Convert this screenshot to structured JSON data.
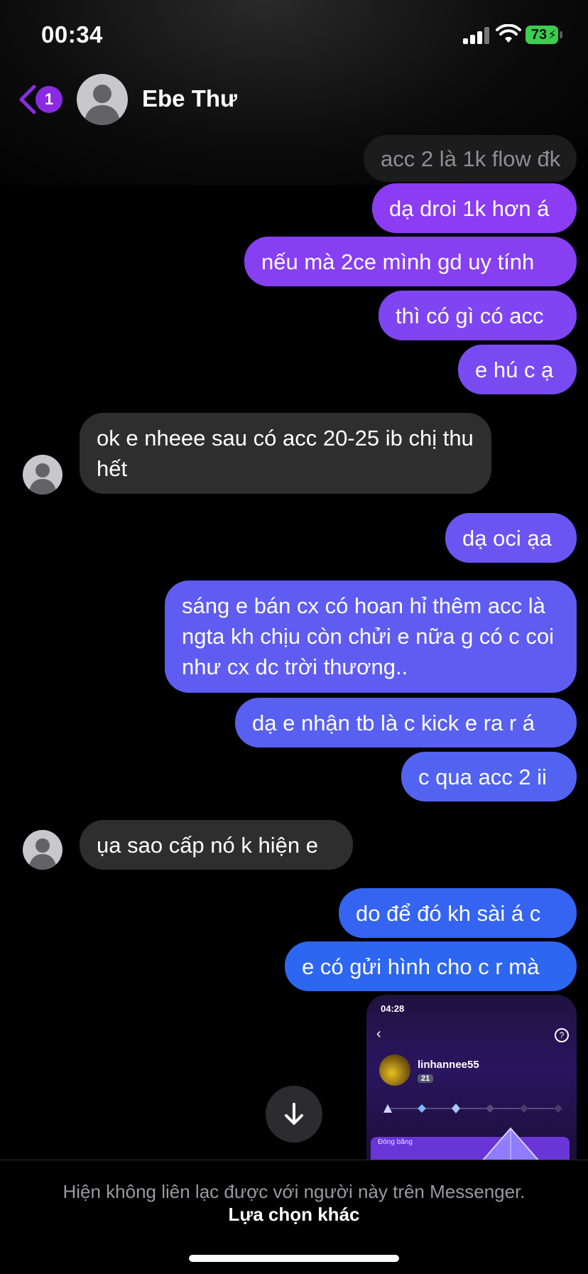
{
  "status_bar": {
    "time": "00:34",
    "battery": "73"
  },
  "header": {
    "unread_count": "1",
    "contact_name": "Ebe Thư"
  },
  "messages": [
    {
      "from": "them",
      "text": "acc 2 là 1k flow đk"
    },
    {
      "from": "me",
      "text": "dạ droi 1k hơn á"
    },
    {
      "from": "me",
      "text": "nếu mà 2ce mình gd uy tính"
    },
    {
      "from": "me",
      "text": "thì có gì có acc"
    },
    {
      "from": "me",
      "text": "e hú c ạ"
    },
    {
      "from": "them",
      "text": "ok e nheee sau có acc 20-25 ib chị thu hết"
    },
    {
      "from": "me",
      "text": "dạ oci ạa"
    },
    {
      "from": "me",
      "text": "sáng e bán cx có hoan hỉ thêm acc là ngta kh chịu còn chửi e nữa g có c coi như cx dc trời thương.."
    },
    {
      "from": "me",
      "text": "dạ e nhận tb là c kick e ra r á"
    },
    {
      "from": "me",
      "text": "c qua acc 2 ii"
    },
    {
      "from": "them",
      "text": "ụa sao cấp nó k hiện e"
    },
    {
      "from": "me",
      "text": "do để đó kh sài á c"
    },
    {
      "from": "me",
      "text": "e có gửi hình cho c r mà"
    }
  ],
  "attachment": {
    "time": "04:28",
    "username": "linhannee55",
    "level": "21",
    "card_label": "Đóng băng"
  },
  "footer": {
    "notice": "Hiện không liên lạc được với người này trên Messenger.",
    "other_options": "Lựa chọn khác"
  },
  "colors": {
    "bubble_top": "#8a3ff0",
    "bubble_bottom": "#2c65f0",
    "received": "#2e2e2e",
    "badge": "#8a2be2",
    "battery": "#3ccd4f"
  },
  "icons": [
    "back-chevron-icon",
    "avatar-icon",
    "arrow-down-icon",
    "signal-icon",
    "wifi-icon",
    "battery-icon"
  ]
}
